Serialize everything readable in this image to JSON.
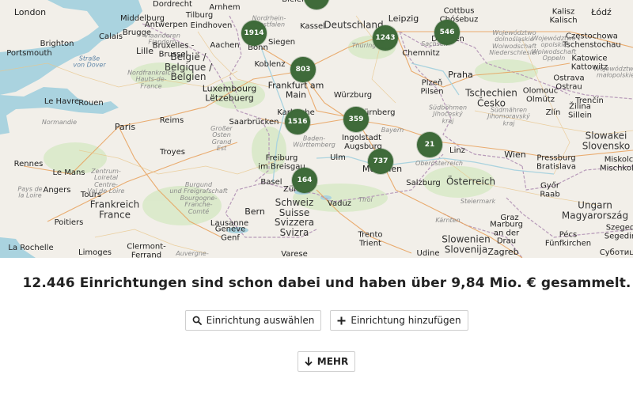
{
  "map": {
    "places": [
      {
        "id": "london",
        "text": "London",
        "cls": "big"
      },
      {
        "id": "dordrecht",
        "text": "Dordrecht",
        "cls": "city"
      },
      {
        "id": "tilburg",
        "text": "Tilburg",
        "cls": "city"
      },
      {
        "id": "bielefeld",
        "text": "Bielefeld",
        "cls": "city"
      },
      {
        "id": "kalisz",
        "text": "Kalisz\nKalisch",
        "cls": "city"
      },
      {
        "id": "lodz",
        "text": "Łódź",
        "cls": "big"
      },
      {
        "id": "middelburg",
        "text": "Middelburg",
        "cls": "city"
      },
      {
        "id": "antwerpen",
        "text": "Antwerpen",
        "cls": "city"
      },
      {
        "id": "eindhoven",
        "text": "Eindhoven",
        "cls": "city"
      },
      {
        "id": "arnhem",
        "text": "Arnhem",
        "cls": "city"
      },
      {
        "id": "nrw",
        "text": "Nordrhein-\nWestfalen",
        "cls": "region"
      },
      {
        "id": "deutschland",
        "text": "Deutschland",
        "cls": "country"
      },
      {
        "id": "leipzig",
        "text": "Leipzig",
        "cls": "big"
      },
      {
        "id": "cottbus",
        "text": "Cottbus\nChóśebuz",
        "cls": "city"
      },
      {
        "id": "czestochowa",
        "text": "Częstochowa\nTschenstochau",
        "cls": "city"
      },
      {
        "id": "brugge",
        "text": "Brugge",
        "cls": "city"
      },
      {
        "id": "calais",
        "text": "Calais",
        "cls": "city"
      },
      {
        "id": "vlaanderen",
        "text": "Vlaanderen\nFlandern",
        "cls": "region"
      },
      {
        "id": "bruxelles",
        "text": "Bruxelles -\nBrussel",
        "cls": "city"
      },
      {
        "id": "aachen",
        "text": "Aachen",
        "cls": "city"
      },
      {
        "id": "siegen",
        "text": "Siegen",
        "cls": "city"
      },
      {
        "id": "kassel",
        "text": "Kassel",
        "cls": "city"
      },
      {
        "id": "thueringen",
        "text": "Thüringen",
        "cls": "region"
      },
      {
        "id": "sachsen",
        "text": "Sachsen",
        "cls": "region"
      },
      {
        "id": "dresden",
        "text": "Dresden",
        "cls": "city"
      },
      {
        "id": "dolnoslaskie",
        "text": "Województwo\ndolnośląskie\nWoiwodschaft\nNiederschlesien",
        "cls": "region"
      },
      {
        "id": "opolskie",
        "text": "Województwo\nopolskie\nWoiwodschaft\nOppeln",
        "cls": "region"
      },
      {
        "id": "malopolskie",
        "text": "Województwo\nmałopolskie",
        "cls": "region"
      },
      {
        "id": "katowice",
        "text": "Katowice\nKattowitz",
        "cls": "city"
      },
      {
        "id": "brighton",
        "text": "Brighton",
        "cls": "city"
      },
      {
        "id": "portsmouth",
        "text": "Portsmouth",
        "cls": "city"
      },
      {
        "id": "lille",
        "text": "Lille",
        "cls": "big"
      },
      {
        "id": "belgie",
        "text": "België /\nBelgique /\nBelgien",
        "cls": "country"
      },
      {
        "id": "bonn",
        "text": "Bonn",
        "cls": "city"
      },
      {
        "id": "koblenz",
        "text": "Koblenz",
        "cls": "city"
      },
      {
        "id": "chemnitz",
        "text": "Chemnitz",
        "cls": "city"
      },
      {
        "id": "strasse",
        "text": "Straße\nvon Dover",
        "cls": "water"
      },
      {
        "id": "plzen",
        "text": "Plzeň\nPilsen",
        "cls": "city"
      },
      {
        "id": "praha",
        "text": "Praha",
        "cls": "big"
      },
      {
        "id": "ostrava",
        "text": "Ostrava\nOstrau",
        "cls": "city"
      },
      {
        "id": "nordfrankreich",
        "text": "Nordfrankreich\nHauts-de-\nFrance",
        "cls": "region"
      },
      {
        "id": "frankfurt",
        "text": "Frankfurt am\nMain",
        "cls": "big"
      },
      {
        "id": "tschechien",
        "text": "Tschechien\nČesko",
        "cls": "country"
      },
      {
        "id": "olomouc",
        "text": "Olomouc\nOlmütz",
        "cls": "city"
      },
      {
        "id": "trencin",
        "text": "Trenčín",
        "cls": "city"
      },
      {
        "id": "lehavre",
        "text": "Le Havre",
        "cls": "city"
      },
      {
        "id": "rouen",
        "text": "Rouen",
        "cls": "city"
      },
      {
        "id": "luxembourg",
        "text": "Luxembourg\nLëtzebuerg",
        "cls": "big"
      },
      {
        "id": "wurzburg",
        "text": "Würzburg",
        "cls": "city"
      },
      {
        "id": "nurnberg",
        "text": "Nürnberg",
        "cls": "city"
      },
      {
        "id": "zilina",
        "text": "Žilina\nSillein",
        "cls": "city"
      },
      {
        "id": "normandie",
        "text": "Normandie",
        "cls": "region"
      },
      {
        "id": "reims",
        "text": "Reims",
        "cls": "city"
      },
      {
        "id": "saarbrucken",
        "text": "Saarbrücken",
        "cls": "city"
      },
      {
        "id": "karlsruhe",
        "text": "Karlsruhe",
        "cls": "city"
      },
      {
        "id": "ingolstadt",
        "text": "Ingolstadt",
        "cls": "city"
      },
      {
        "id": "jihocesky",
        "text": "Südböhmen\nJihočeský\nkraj",
        "cls": "region"
      },
      {
        "id": "jihomoravsky",
        "text": "Südmähren\nJihomoravský\nkraj",
        "cls": "region"
      },
      {
        "id": "zlin",
        "text": "Zlín",
        "cls": "city"
      },
      {
        "id": "paris",
        "text": "Paris",
        "cls": "big"
      },
      {
        "id": "grandest",
        "text": "Großer\nOsten\nGrand\nEst",
        "cls": "region"
      },
      {
        "id": "bayern",
        "text": "Bayern",
        "cls": "region"
      },
      {
        "id": "bw",
        "text": "Baden-\nWürttemberg",
        "cls": "region"
      },
      {
        "id": "augsburg",
        "text": "Augsburg",
        "cls": "city"
      },
      {
        "id": "linz",
        "text": "Linz",
        "cls": "city"
      },
      {
        "id": "slowakei",
        "text": "Slowakei\nSlovensko",
        "cls": "country"
      },
      {
        "id": "troyes",
        "text": "Troyes",
        "cls": "city"
      },
      {
        "id": "ulm",
        "text": "Ulm",
        "cls": "city"
      },
      {
        "id": "oberosterreich",
        "text": "Oberösterreich",
        "cls": "region"
      },
      {
        "id": "wien",
        "text": "Wien",
        "cls": "big"
      },
      {
        "id": "pressburg",
        "text": "Pressburg\nBratislava",
        "cls": "city"
      },
      {
        "id": "rennes",
        "text": "Rennes",
        "cls": "city"
      },
      {
        "id": "freiburg",
        "text": "Freiburg\nim Breisgau",
        "cls": "city"
      },
      {
        "id": "munchen",
        "text": "München",
        "cls": "big"
      },
      {
        "id": "miskolc",
        "text": "Miskolc\nMischkolz",
        "cls": "city"
      },
      {
        "id": "lemans",
        "text": "Le Mans",
        "cls": "city"
      },
      {
        "id": "centre",
        "text": "Zentrum-\nLoiretal\nCentre-\nVal de Loire",
        "cls": "region"
      },
      {
        "id": "bourgogne",
        "text": "Burgund\nund Freigrafschaft\nBourgogne-\nFranche-\nComté",
        "cls": "region"
      },
      {
        "id": "basel",
        "text": "Basel",
        "cls": "city"
      },
      {
        "id": "zurich",
        "text": "Zürich",
        "cls": "city"
      },
      {
        "id": "salzburg",
        "text": "Salzburg",
        "cls": "city"
      },
      {
        "id": "osterreich",
        "text": "Österreich",
        "cls": "country"
      },
      {
        "id": "gyor",
        "text": "Győr\nRaab",
        "cls": "city"
      },
      {
        "id": "paysdelaloire",
        "text": "Pays de\nla Loire",
        "cls": "region"
      },
      {
        "id": "angers",
        "text": "Angers",
        "cls": "city"
      },
      {
        "id": "tours",
        "text": "Tours",
        "cls": "city"
      },
      {
        "id": "frankreich",
        "text": "Frankreich\nFrance",
        "cls": "country"
      },
      {
        "id": "schweiz",
        "text": "Schweiz\nSuisse\nSvizzera\nSvizra",
        "cls": "country"
      },
      {
        "id": "bern",
        "text": "Bern",
        "cls": "big"
      },
      {
        "id": "vaduz",
        "text": "Vaduz",
        "cls": "city"
      },
      {
        "id": "tirol",
        "text": "Tirol",
        "cls": "region"
      },
      {
        "id": "steiermark",
        "text": "Steiermark",
        "cls": "region"
      },
      {
        "id": "ungarn",
        "text": "Ungarn\nMagyarország",
        "cls": "country"
      },
      {
        "id": "poitiers",
        "text": "Poitiers",
        "cls": "city"
      },
      {
        "id": "lausanne",
        "text": "Lausanne",
        "cls": "city"
      },
      {
        "id": "kaernten",
        "text": "Kärnten",
        "cls": "region"
      },
      {
        "id": "graz",
        "text": "Graz",
        "cls": "city"
      },
      {
        "id": "marburg",
        "text": "Marburg\nan der\nDrau",
        "cls": "city"
      },
      {
        "id": "pecs",
        "text": "Pécs\nFünfkirchen",
        "cls": "city"
      },
      {
        "id": "szeged",
        "text": "Szeged\nSegedin",
        "cls": "city"
      },
      {
        "id": "geneve",
        "text": "Genève\nGenf",
        "cls": "city"
      },
      {
        "id": "trento",
        "text": "Trento\nTrient",
        "cls": "city"
      },
      {
        "id": "slovenien",
        "text": "Slowenien\nSlovenija",
        "cls": "country"
      },
      {
        "id": "larochelle",
        "text": "La Rochelle",
        "cls": "city"
      },
      {
        "id": "limoges",
        "text": "Limoges",
        "cls": "city"
      },
      {
        "id": "clermont",
        "text": "Clermont-\nFerrand",
        "cls": "city"
      },
      {
        "id": "auvergne",
        "text": "Auvergne-",
        "cls": "region"
      },
      {
        "id": "varese",
        "text": "Varese",
        "cls": "city"
      },
      {
        "id": "udine",
        "text": "Udine",
        "cls": "city"
      },
      {
        "id": "zagreb",
        "text": "Zagreb",
        "cls": "big"
      },
      {
        "id": "subotica",
        "text": "Суботица",
        "cls": "city"
      }
    ],
    "clusters": [
      {
        "id": "top",
        "label": ""
      },
      {
        "id": "dusseldorf",
        "label": "1914"
      },
      {
        "id": "leipzig",
        "label": "1243"
      },
      {
        "id": "dresden",
        "label": "546"
      },
      {
        "id": "frankfurt",
        "label": "803"
      },
      {
        "id": "mannheim",
        "label": "1516"
      },
      {
        "id": "nurnberg",
        "label": "359"
      },
      {
        "id": "passau",
        "label": "21"
      },
      {
        "id": "munchen",
        "label": "737"
      },
      {
        "id": "zurich",
        "label": "164"
      }
    ]
  },
  "headline": "12.446 Einrichtungen sind schon dabei und haben über 9,84 Mio. € gesammelt.",
  "buttons": {
    "select_label": "Einrichtung auswählen",
    "add_label": "Einrichtung hinzufügen",
    "more_label": "MEHR"
  },
  "icons": {
    "select": "search-icon",
    "add": "plus-icon",
    "more": "arrow-down-icon"
  },
  "colors": {
    "cluster": "#3f6b3a",
    "sea": "#aad3df",
    "land": "#f2efe9"
  }
}
